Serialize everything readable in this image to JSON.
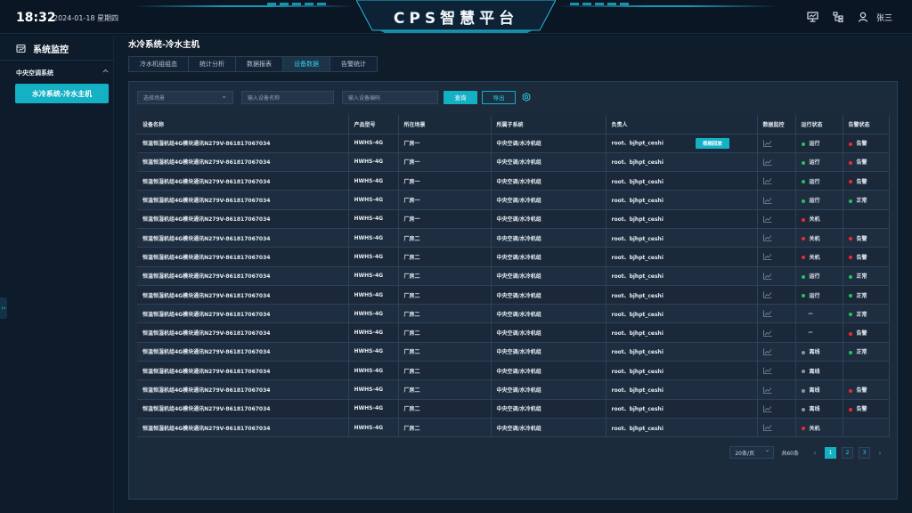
{
  "header": {
    "time": "18:32",
    "date": "2024-01-18 星期四",
    "title": "CPS智慧平台",
    "username": "张三",
    "icons": [
      "monitor-icon",
      "org-chart-icon",
      "user-icon"
    ]
  },
  "sidebar": {
    "title": "系统监控",
    "group": "中央空调系统",
    "active_item": "水冷系统-冷水主机",
    "handle": "››"
  },
  "page": {
    "title": "水冷系统-冷水主机",
    "tabs": [
      {
        "label": "冷水机组组态",
        "active": false
      },
      {
        "label": "统计分析",
        "active": false
      },
      {
        "label": "数据报表",
        "active": false
      },
      {
        "label": "设备数据",
        "active": true
      },
      {
        "label": "告警统计",
        "active": false
      }
    ]
  },
  "filters": {
    "scene_placeholder": "选择场景",
    "name_placeholder": "输入设备名称",
    "code_placeholder": "输入设备编码",
    "query_label": "查询",
    "export_label": "导出"
  },
  "table": {
    "headers": [
      "设备名称",
      "产品型号",
      "所在场景",
      "所属子系统",
      "负责人",
      "数据监控",
      "运行状态",
      "告警状态"
    ],
    "video_label": "视频回放",
    "rows": [
      {
        "name": "恒温恒湿机组4G模块通讯N279V-861817067034",
        "model": "HWHS-4G",
        "scene": "厂房一",
        "sub": "中央空调/水冷机组",
        "owner": "root、bjhpt_ceshi",
        "video": true,
        "run": "运行",
        "run_color": "#22c55e",
        "alarm": "告警",
        "alarm_color": "#ef2b2b"
      },
      {
        "name": "恒温恒湿机组4G模块通讯N279V-861817067034",
        "model": "HWHS-4G",
        "scene": "厂房一",
        "sub": "中央空调/水冷机组",
        "owner": "root、bjhpt_ceshi",
        "video": false,
        "run": "运行",
        "run_color": "#22c55e",
        "alarm": "告警",
        "alarm_color": "#ef2b2b"
      },
      {
        "name": "恒温恒湿机组4G模块通讯N279V-861817067034",
        "model": "HWHS-4G",
        "scene": "厂房一",
        "sub": "中央空调/水冷机组",
        "owner": "root、bjhpt_ceshi",
        "video": false,
        "run": "运行",
        "run_color": "#22c55e",
        "alarm": "告警",
        "alarm_color": "#ef2b2b"
      },
      {
        "name": "恒温恒湿机组4G模块通讯N279V-861817067034",
        "model": "HWHS-4G",
        "scene": "厂房一",
        "sub": "中央空调/水冷机组",
        "owner": "root、bjhpt_ceshi",
        "video": false,
        "run": "运行",
        "run_color": "#22c55e",
        "alarm": "正常",
        "alarm_color": "#22c55e"
      },
      {
        "name": "恒温恒湿机组4G模块通讯N279V-861817067034",
        "model": "HWHS-4G",
        "scene": "厂房一",
        "sub": "中央空调/水冷机组",
        "owner": "root、bjhpt_ceshi",
        "video": false,
        "run": "关机",
        "run_color": "#ef2b2b",
        "alarm": "",
        "alarm_color": ""
      },
      {
        "name": "恒温恒湿机组4G模块通讯N279V-861817067034",
        "model": "HWHS-4G",
        "scene": "厂房二",
        "sub": "中央空调/水冷机组",
        "owner": "root、bjhpt_ceshi",
        "video": false,
        "run": "关机",
        "run_color": "#ef2b2b",
        "alarm": "告警",
        "alarm_color": "#ef2b2b"
      },
      {
        "name": "恒温恒湿机组4G模块通讯N279V-861817067034",
        "model": "HWHS-4G",
        "scene": "厂房二",
        "sub": "中央空调/水冷机组",
        "owner": "root、bjhpt_ceshi",
        "video": false,
        "run": "关机",
        "run_color": "#ef2b2b",
        "alarm": "告警",
        "alarm_color": "#ef2b2b"
      },
      {
        "name": "恒温恒湿机组4G模块通讯N279V-861817067034",
        "model": "HWHS-4G",
        "scene": "厂房二",
        "sub": "中央空调/水冷机组",
        "owner": "root、bjhpt_ceshi",
        "video": false,
        "run": "运行",
        "run_color": "#22c55e",
        "alarm": "正常",
        "alarm_color": "#22c55e"
      },
      {
        "name": "恒温恒湿机组4G模块通讯N279V-861817067034",
        "model": "HWHS-4G",
        "scene": "厂房二",
        "sub": "中央空调/水冷机组",
        "owner": "root、bjhpt_ceshi",
        "video": false,
        "run": "运行",
        "run_color": "#22c55e",
        "alarm": "正常",
        "alarm_color": "#22c55e"
      },
      {
        "name": "恒温恒湿机组4G模块通讯N279V-861817067034",
        "model": "HWHS-4G",
        "scene": "厂房二",
        "sub": "中央空调/水冷机组",
        "owner": "root、bjhpt_ceshi",
        "video": false,
        "run": "--",
        "run_color": "",
        "alarm": "正常",
        "alarm_color": "#22c55e"
      },
      {
        "name": "恒温恒湿机组4G模块通讯N279V-861817067034",
        "model": "HWHS-4G",
        "scene": "厂房二",
        "sub": "中央空调/水冷机组",
        "owner": "root、bjhpt_ceshi",
        "video": false,
        "run": "--",
        "run_color": "",
        "alarm": "告警",
        "alarm_color": "#ef2b2b"
      },
      {
        "name": "恒温恒湿机组4G模块通讯N279V-861817067034",
        "model": "HWHS-4G",
        "scene": "厂房二",
        "sub": "中央空调/水冷机组",
        "owner": "root、bjhpt_ceshi",
        "video": false,
        "run": "离线",
        "run_color": "#8a96a3",
        "alarm": "正常",
        "alarm_color": "#22c55e"
      },
      {
        "name": "恒温恒湿机组4G模块通讯N279V-861817067034",
        "model": "HWHS-4G",
        "scene": "厂房二",
        "sub": "中央空调/水冷机组",
        "owner": "root、bjhpt_ceshi",
        "video": false,
        "run": "离线",
        "run_color": "#8a96a3",
        "alarm": "",
        "alarm_color": ""
      },
      {
        "name": "恒温恒湿机组4G模块通讯N279V-861817067034",
        "model": "HWHS-4G",
        "scene": "厂房二",
        "sub": "中央空调/水冷机组",
        "owner": "root、bjhpt_ceshi",
        "video": false,
        "run": "离线",
        "run_color": "#8a96a3",
        "alarm": "告警",
        "alarm_color": "#ef2b2b"
      },
      {
        "name": "恒温恒湿机组4G模块通讯N279V-861817067034",
        "model": "HWHS-4G",
        "scene": "厂房二",
        "sub": "中央空调/水冷机组",
        "owner": "root、bjhpt_ceshi",
        "video": false,
        "run": "离线",
        "run_color": "#8a96a3",
        "alarm": "告警",
        "alarm_color": "#ef2b2b"
      },
      {
        "name": "恒温恒湿机组4G模块通讯N279V-861817067034",
        "model": "HWHS-4G",
        "scene": "厂房二",
        "sub": "中央空调/水冷机组",
        "owner": "root、bjhpt_ceshi",
        "video": false,
        "run": "关机",
        "run_color": "#ef2b2b",
        "alarm": "",
        "alarm_color": ""
      }
    ]
  },
  "pagination": {
    "page_size": "20条/页",
    "total": "共60条",
    "pages": [
      "1",
      "2",
      "3"
    ],
    "current": "1",
    "prev": "‹",
    "next": "›"
  },
  "colors": {
    "accent": "#14b0c4",
    "running": "#22c55e",
    "alarm": "#ef2b2b",
    "offline": "#8a96a3"
  }
}
